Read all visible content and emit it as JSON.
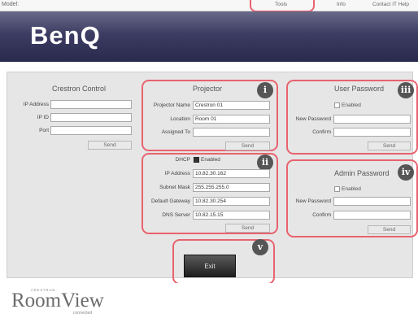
{
  "header": {
    "model_label": "Model:",
    "nav": [
      "Tools",
      "Info",
      "Contact IT Help"
    ]
  },
  "brand": {
    "logo_text": "BenQ"
  },
  "crestron": {
    "title": "Crestron Control",
    "ip_address_label": "IP Address",
    "ip_id_label": "IP ID",
    "port_label": "Port",
    "ip_address": "",
    "ip_id": "",
    "port": "",
    "send_label": "Send"
  },
  "projector": {
    "title": "Projector",
    "name_label": "Projector Name",
    "location_label": "Location",
    "assigned_label": "Assigned To",
    "name": "Crestron 01",
    "location": "Room 01",
    "assigned": "",
    "send_label": "Send"
  },
  "network": {
    "dhcp_label": "DHCP",
    "dhcp_enabled": true,
    "enabled_label": "Enabled",
    "ip_label": "IP Address",
    "mask_label": "Subnet Mask",
    "gateway_label": "Default Gateway",
    "dns_label": "DNS Server",
    "ip": "10.82.30.162",
    "mask": "255.255.255.0",
    "gateway": "10.82.30.254",
    "dns": "10.82.15.15",
    "send_label": "Send"
  },
  "user_password": {
    "title": "User Password",
    "enabled_label": "Enabled",
    "enabled": false,
    "new_label": "New Password",
    "confirm_label": "Confirm",
    "send_label": "Send"
  },
  "admin_password": {
    "title": "Admin Password",
    "enabled_label": "Enabled",
    "enabled": false,
    "new_label": "New Password",
    "confirm_label": "Confirm",
    "send_label": "Send"
  },
  "exit_label": "Exit",
  "callouts": [
    "i",
    "ii",
    "iii",
    "iv",
    "v"
  ],
  "footer": {
    "small_text": "CRESTRON",
    "product": "RoomView",
    "sub": "connected"
  },
  "colors": {
    "highlight": "#e8636f",
    "badge": "#555555",
    "banner": "#2a2a4d"
  }
}
